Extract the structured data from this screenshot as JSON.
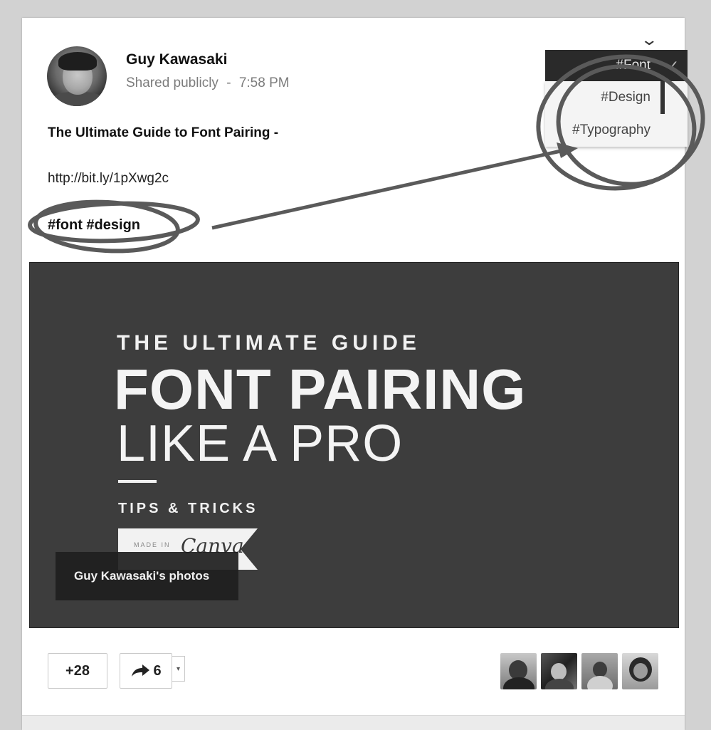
{
  "post": {
    "author": "Guy Kawasaki",
    "visibility": "Shared publicly",
    "separator": "-",
    "time": "7:58 PM",
    "title": "The Ultimate Guide to Font Pairing -",
    "link": "http://bit.ly/1pXwg2c",
    "tags": "#font #design"
  },
  "menu": {
    "toggle_icon": "chevron-down-icon"
  },
  "tag_dropdown": {
    "selected": "#Font",
    "options": [
      "#Design",
      "#Typography"
    ]
  },
  "image": {
    "line1": "THE ULTIMATE GUIDE",
    "line2": "FONT PAIRING",
    "line3": "LIKE A PRO",
    "line4": "TIPS & TRICKS",
    "badge_small": "MADE IN",
    "badge_brand": "Canva",
    "caption": "Guy Kawasaki's photos"
  },
  "actions": {
    "plus_count": "+28",
    "share_count": "6",
    "share_icon": "share-arrow-icon"
  },
  "colors": {
    "background": "#d2d2d2",
    "card": "#ffffff",
    "image_bg": "#3d3d3d",
    "annotation": "#555555"
  }
}
